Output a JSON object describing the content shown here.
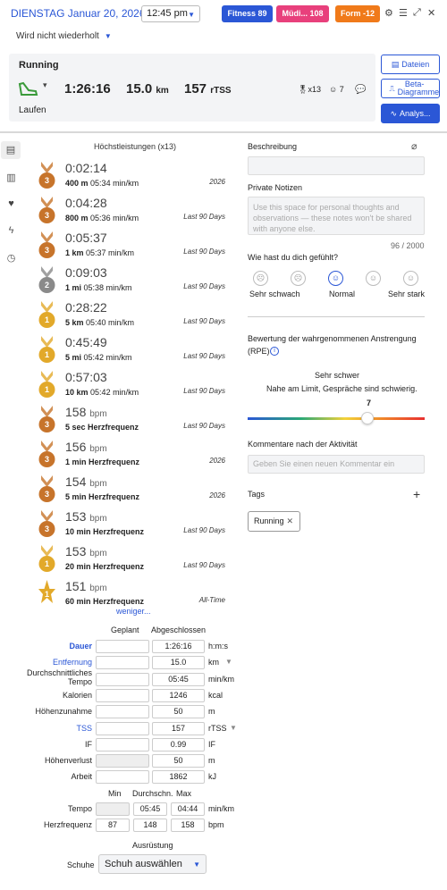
{
  "header": {
    "date": "DIENSTAG Januar 20, 2026",
    "time": "12:45 pm",
    "badges": {
      "fitness": "Fitness 89",
      "mued": "Müdi... 108",
      "form": "Form -12"
    },
    "repeat": "Wird nicht wiederholt"
  },
  "activity": {
    "title": "Running",
    "duration": "1:26:16",
    "distance": "15.0",
    "distance_unit": "km",
    "tss": "157",
    "tss_unit": "rTSS",
    "medals": "x13",
    "smiles": "7",
    "subtitle": "Laufen"
  },
  "buttons": {
    "files": "Dateien",
    "beta": "Beta-Diagramme",
    "analysis": "Analys..."
  },
  "best": {
    "title": "Höchstleistungen (x13)",
    "less": "weniger...",
    "items": [
      {
        "val": "0:02:14",
        "unit": "",
        "medal": "3",
        "kind": "bronze",
        "dist": "400 m",
        "pace": "05:34 min/km",
        "period": "2026"
      },
      {
        "val": "0:04:28",
        "unit": "",
        "medal": "3",
        "kind": "bronze",
        "dist": "800 m",
        "pace": "05:36 min/km",
        "period": "Last 90 Days"
      },
      {
        "val": "0:05:37",
        "unit": "",
        "medal": "3",
        "kind": "bronze",
        "dist": "1 km",
        "pace": "05:37 min/km",
        "period": "Last 90 Days"
      },
      {
        "val": "0:09:03",
        "unit": "",
        "medal": "2",
        "kind": "silver",
        "dist": "1 mi",
        "pace": "05:38 min/km",
        "period": "Last 90 Days"
      },
      {
        "val": "0:28:22",
        "unit": "",
        "medal": "1",
        "kind": "gold",
        "dist": "5 km",
        "pace": "05:40 min/km",
        "period": "Last 90 Days"
      },
      {
        "val": "0:45:49",
        "unit": "",
        "medal": "1",
        "kind": "gold",
        "dist": "5 mi",
        "pace": "05:42 min/km",
        "period": "Last 90 Days"
      },
      {
        "val": "0:57:03",
        "unit": "",
        "medal": "1",
        "kind": "gold",
        "dist": "10 km",
        "pace": "05:42 min/km",
        "period": "Last 90 Days"
      },
      {
        "val": "158",
        "unit": "bpm",
        "medal": "3",
        "kind": "bronze",
        "dist": "5 sec Herzfrequenz",
        "pace": "",
        "period": "Last 90 Days"
      },
      {
        "val": "156",
        "unit": "bpm",
        "medal": "3",
        "kind": "bronze",
        "dist": "1 min Herzfrequenz",
        "pace": "",
        "period": "2026"
      },
      {
        "val": "154",
        "unit": "bpm",
        "medal": "3",
        "kind": "bronze",
        "dist": "5 min Herzfrequenz",
        "pace": "",
        "period": "2026"
      },
      {
        "val": "153",
        "unit": "bpm",
        "medal": "3",
        "kind": "bronze",
        "dist": "10 min Herzfrequenz",
        "pace": "",
        "period": "Last 90 Days"
      },
      {
        "val": "153",
        "unit": "bpm",
        "medal": "1",
        "kind": "gold",
        "dist": "20 min Herzfrequenz",
        "pace": "",
        "period": "Last 90 Days"
      },
      {
        "val": "151",
        "unit": "bpm",
        "medal": "1",
        "kind": "star",
        "dist": "60 min Herzfrequenz",
        "pace": "",
        "period": "All-Time"
      }
    ]
  },
  "table": {
    "h_plan": "Geplant",
    "h_done": "Abgeschlossen",
    "rows": [
      {
        "label": "Dauer",
        "plan": "",
        "done": "1:26:16",
        "unit": "h:m:s"
      },
      {
        "label": "Entfernung",
        "plan": "",
        "done": "15.0",
        "unit": "km"
      },
      {
        "label": "Durchschnittliches Tempo",
        "plan": "",
        "done": "05:45",
        "unit": "min/km"
      },
      {
        "label": "Kalorien",
        "plan": "",
        "done": "1246",
        "unit": "kcal"
      },
      {
        "label": "Höhenzunahme",
        "plan": "",
        "done": "50",
        "unit": "m"
      },
      {
        "label": "TSS",
        "plan": "",
        "done": "157",
        "unit": "rTSS"
      },
      {
        "label": "IF",
        "plan": "",
        "done": "0.99",
        "unit": "IF"
      },
      {
        "label": "Höhenverlust",
        "plan": "",
        "done": "50",
        "unit": "m"
      },
      {
        "label": "Arbeit",
        "plan": "",
        "done": "1862",
        "unit": "kJ"
      }
    ]
  },
  "minmax": {
    "h_min": "Min",
    "h_avg": "Durchschn.",
    "h_max": "Max",
    "rows": [
      {
        "label": "Tempo",
        "min": "",
        "avg": "05:45",
        "max": "04:44",
        "unit": "min/km"
      },
      {
        "label": "Herzfrequenz",
        "min": "87",
        "avg": "148",
        "max": "158",
        "unit": "bpm"
      }
    ]
  },
  "equipment": {
    "title": "Ausrüstung",
    "shoe_label": "Schuhe",
    "shoe_value": "Schuh auswählen"
  },
  "right": {
    "desc_label": "Beschreibung",
    "notes_label": "Private Notizen",
    "notes_placeholder": "Use this space for personal thoughts and observations — these notes won't be shared with anyone else.",
    "notes_count": "96 / 2000",
    "feel_label": "Wie hast du dich gefühlt?",
    "feel_low": "Sehr schwach",
    "feel_mid": "Normal",
    "feel_high": "Sehr stark",
    "rpe_l1": "Bewertung der wahrgenommenen Anstrengung",
    "rpe_l2": "(RPE)",
    "rpe_heading": "Sehr schwer",
    "rpe_desc": "Nahe am Limit, Gespräche sind schwierig.",
    "rpe_value": "7",
    "comment_label": "Kommentare nach der Aktivität",
    "comment_placeholder": "Geben Sie einen neuen Kommentar ein",
    "tags_label": "Tags",
    "tag": "Running"
  },
  "colors": {
    "accent": "#2b57d6",
    "bronze": "#c7742b",
    "silver": "#8a8a8a",
    "gold": "#e2a92a"
  }
}
